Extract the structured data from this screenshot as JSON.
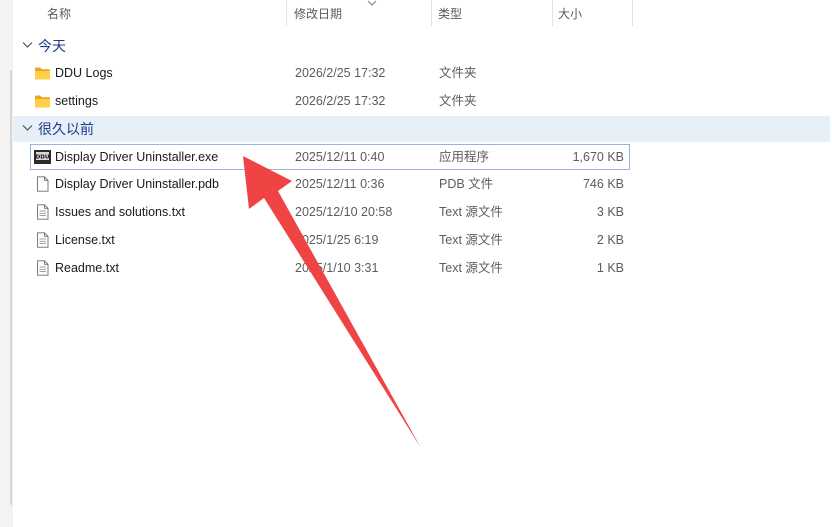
{
  "columns": {
    "name": "名称",
    "date": "修改日期",
    "type": "类型",
    "size": "大小"
  },
  "groups": [
    {
      "label": "今天",
      "items": [
        {
          "name": "DDU Logs",
          "date": "2026/2/25 17:32",
          "type": "文件夹",
          "size": "",
          "icon": "folder-icon"
        },
        {
          "name": "settings",
          "date": "2026/2/25 17:32",
          "type": "文件夹",
          "size": "",
          "icon": "folder-icon"
        }
      ]
    },
    {
      "label": "很久以前",
      "items": [
        {
          "name": "Display Driver Uninstaller.exe",
          "date": "2025/12/11 0:40",
          "type": "应用程序",
          "size": "1,670 KB",
          "icon": "ddu-app-icon"
        },
        {
          "name": "Display Driver Uninstaller.pdb",
          "date": "2025/12/11 0:36",
          "type": "PDB 文件",
          "size": "746 KB",
          "icon": "file-icon"
        },
        {
          "name": "Issues and solutions.txt",
          "date": "2025/12/10 20:58",
          "type": "Text 源文件",
          "size": "3 KB",
          "icon": "text-file-icon"
        },
        {
          "name": "License.txt",
          "date": "2025/1/25 6:19",
          "type": "Text 源文件",
          "size": "2 KB",
          "icon": "text-file-icon"
        },
        {
          "name": "Readme.txt",
          "date": "2025/1/10 3:31",
          "type": "Text 源文件",
          "size": "1 KB",
          "icon": "text-file-icon"
        }
      ]
    }
  ],
  "colors": {
    "group_label": "#1e3a8a",
    "selection": "#e7eff9",
    "annotation_arrow": "#f04444"
  }
}
